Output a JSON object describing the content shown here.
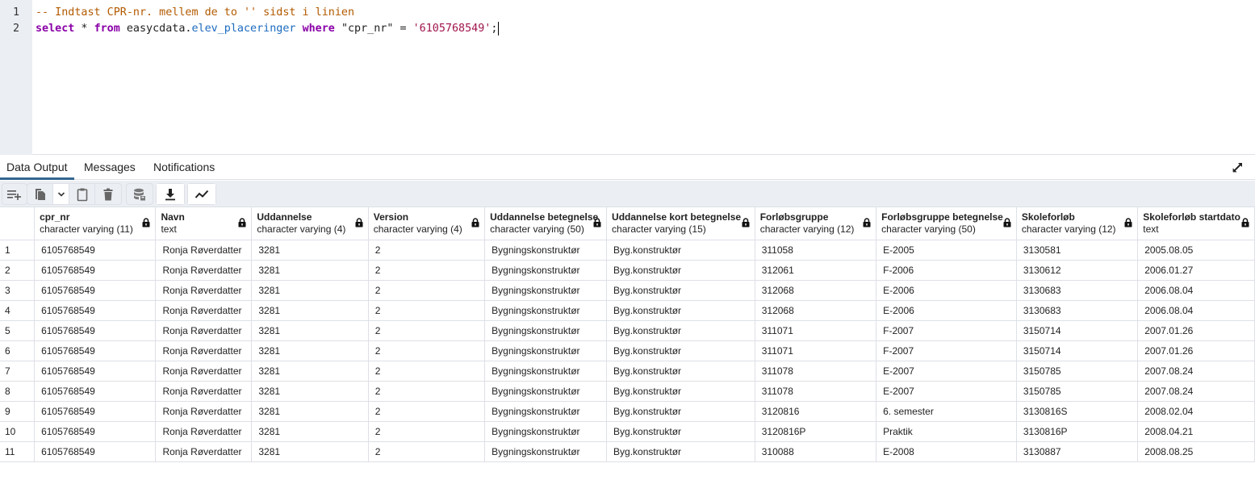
{
  "editor": {
    "lines": [
      {
        "num": "1",
        "comment": "-- Indtast CPR-nr. mellem de to '' sidst i linien"
      },
      {
        "num": "2",
        "kw_select": "select",
        "star": " * ",
        "kw_from": "from",
        "schema": " easycdata.",
        "table": "elev_placeringer",
        "kw_where": "where",
        "column": "\"cpr_nr\"",
        "eq": " = ",
        "value": "'6105768549'",
        "semicolon": ";"
      }
    ]
  },
  "tabs": [
    {
      "label": "Data Output",
      "active": true
    },
    {
      "label": "Messages",
      "active": false
    },
    {
      "label": "Notifications",
      "active": false
    }
  ],
  "toolbar": {
    "buttons": [
      "add-row",
      "copy",
      "copy-options-dropdown",
      "paste",
      "delete",
      "save-data",
      "download",
      "graph-visualiser"
    ]
  },
  "grid": {
    "columns": [
      {
        "name": "cpr_nr",
        "type": "character varying (11)"
      },
      {
        "name": "Navn",
        "type": "text"
      },
      {
        "name": "Uddannelse",
        "type": "character varying (4)"
      },
      {
        "name": "Version",
        "type": "character varying (4)"
      },
      {
        "name": "Uddannelse betegnelse",
        "type": "character varying (50)"
      },
      {
        "name": "Uddannelse kort betegnelse",
        "type": "character varying (15)"
      },
      {
        "name": "Forløbsgruppe",
        "type": "character varying (12)"
      },
      {
        "name": "Forløbsgruppe betegnelse",
        "type": "character varying (50)"
      },
      {
        "name": "Skoleforløb",
        "type": "character varying (12)"
      },
      {
        "name": "Skoleforløb startdato",
        "type": "text"
      }
    ],
    "rows": [
      [
        "1",
        "6105768549",
        "Ronja Røverdatter",
        "3281",
        "2",
        "Bygningskonstruktør",
        "Byg.konstruktør",
        "311058",
        "E-2005",
        "3130581",
        "2005.08.05"
      ],
      [
        "2",
        "6105768549",
        "Ronja Røverdatter",
        "3281",
        "2",
        "Bygningskonstruktør",
        "Byg.konstruktør",
        "312061",
        "F-2006",
        "3130612",
        "2006.01.27"
      ],
      [
        "3",
        "6105768549",
        "Ronja Røverdatter",
        "3281",
        "2",
        "Bygningskonstruktør",
        "Byg.konstruktør",
        "312068",
        "E-2006",
        "3130683",
        "2006.08.04"
      ],
      [
        "4",
        "6105768549",
        "Ronja Røverdatter",
        "3281",
        "2",
        "Bygningskonstruktør",
        "Byg.konstruktør",
        "312068",
        "E-2006",
        "3130683",
        "2006.08.04"
      ],
      [
        "5",
        "6105768549",
        "Ronja Røverdatter",
        "3281",
        "2",
        "Bygningskonstruktør",
        "Byg.konstruktør",
        "311071",
        "F-2007",
        "3150714",
        "2007.01.26"
      ],
      [
        "6",
        "6105768549",
        "Ronja Røverdatter",
        "3281",
        "2",
        "Bygningskonstruktør",
        "Byg.konstruktør",
        "311071",
        "F-2007",
        "3150714",
        "2007.01.26"
      ],
      [
        "7",
        "6105768549",
        "Ronja Røverdatter",
        "3281",
        "2",
        "Bygningskonstruktør",
        "Byg.konstruktør",
        "311078",
        "E-2007",
        "3150785",
        "2007.08.24"
      ],
      [
        "8",
        "6105768549",
        "Ronja Røverdatter",
        "3281",
        "2",
        "Bygningskonstruktør",
        "Byg.konstruktør",
        "311078",
        "E-2007",
        "3150785",
        "2007.08.24"
      ],
      [
        "9",
        "6105768549",
        "Ronja Røverdatter",
        "3281",
        "2",
        "Bygningskonstruktør",
        "Byg.konstruktør",
        "3120816",
        "6. semester",
        "3130816S",
        "2008.02.04"
      ],
      [
        "10",
        "6105768549",
        "Ronja Røverdatter",
        "3281",
        "2",
        "Bygningskonstruktør",
        "Byg.konstruktør",
        "3120816P",
        "Praktik",
        "3130816P",
        "2008.04.21"
      ],
      [
        "11",
        "6105768549",
        "Ronja Røverdatter",
        "3281",
        "2",
        "Bygningskonstruktør",
        "Byg.konstruktør",
        "310088",
        "E-2008",
        "3130887",
        "2008.08.25"
      ]
    ]
  }
}
